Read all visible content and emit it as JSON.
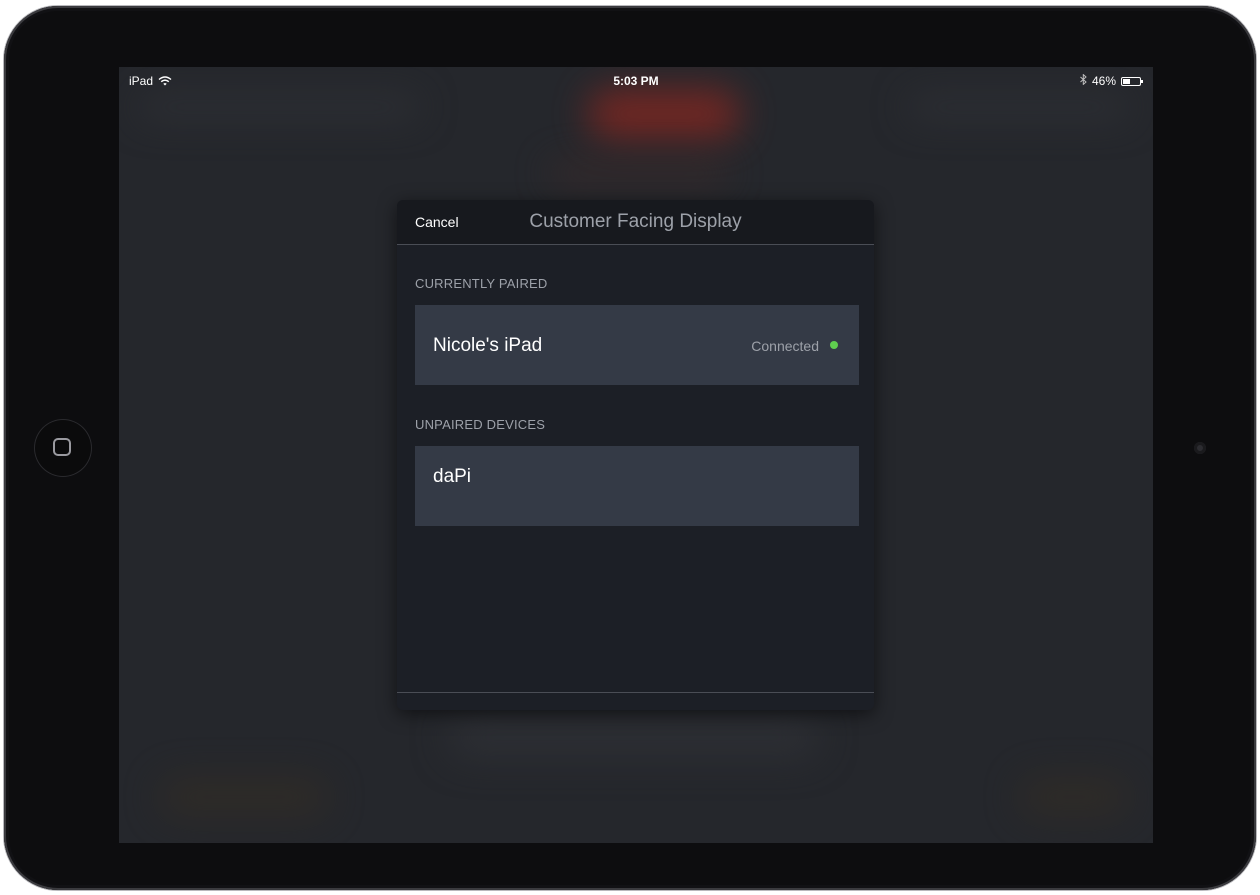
{
  "status_bar": {
    "device": "iPad",
    "time": "5:03 PM",
    "battery": "46%",
    "battery_level": 0.46
  },
  "modal": {
    "cancel_label": "Cancel",
    "title": "Customer Facing Display",
    "paired_section_label": "CURRENTLY PAIRED",
    "paired_devices": [
      {
        "name": "Nicole's iPad",
        "status": "Connected",
        "status_color": "#5fcd4f"
      }
    ],
    "unpaired_section_label": "UNPAIRED DEVICES",
    "unpaired_devices": [
      {
        "name": "daPi"
      }
    ]
  },
  "colors": {
    "modal_bg": "#1c1f26",
    "row_bg": "#343a46",
    "accent_connected": "#5fcd4f"
  }
}
